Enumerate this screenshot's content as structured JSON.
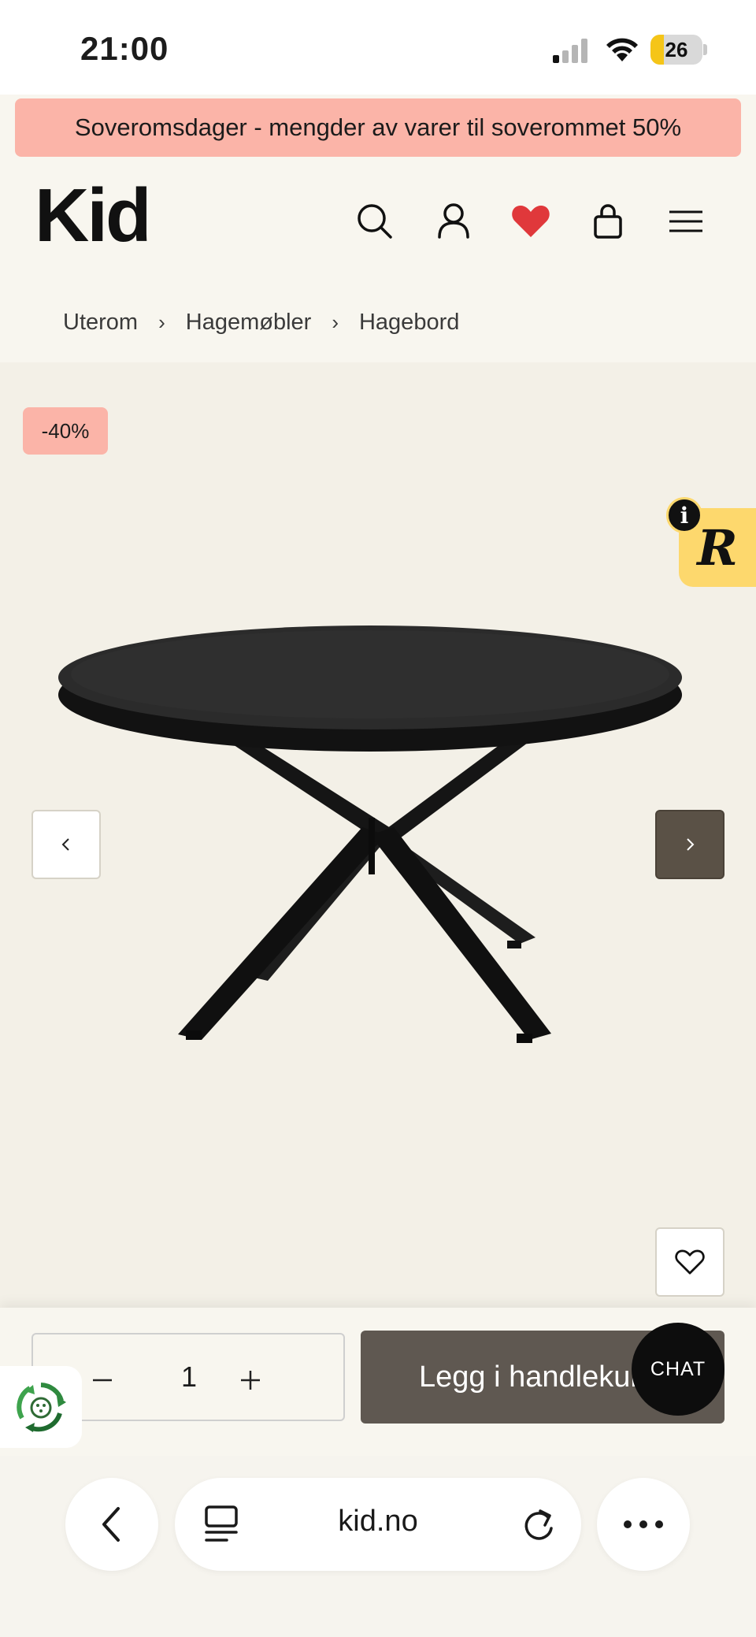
{
  "status_bar": {
    "time": "21:00",
    "battery": "26",
    "battery_level": 0.26,
    "icons": [
      "signal-icon",
      "wifi-icon",
      "battery-icon"
    ]
  },
  "promo": {
    "text": "Soveromsdager - mengder av varer til soverommet 50%",
    "color": "#fbb4a8"
  },
  "header": {
    "logo": "Kid",
    "icons": [
      "search-icon",
      "account-icon",
      "heart-icon",
      "cart-icon",
      "menu-icon"
    ],
    "wishlist_color": "#e0383b"
  },
  "breadcrumb": {
    "items": [
      "Uterom",
      "Hagemøbler",
      "Hagebord"
    ]
  },
  "product": {
    "discount_badge": "-40%",
    "gallery_icons": [
      "chevron-left-icon",
      "chevron-right-icon",
      "heart-outline-icon"
    ]
  },
  "review_widget": {
    "letter": "R",
    "info": "i",
    "color": "#fdd86d"
  },
  "purchase": {
    "quantity": "1",
    "minus": "−",
    "plus": "+",
    "add_to_cart": "Legg i handlekurv",
    "chat": "CHAT",
    "button_color": "#5f5851"
  },
  "browser": {
    "url": "kid.no",
    "icons": [
      "back-icon",
      "tabs-icon",
      "reload-icon",
      "more-icon"
    ]
  }
}
